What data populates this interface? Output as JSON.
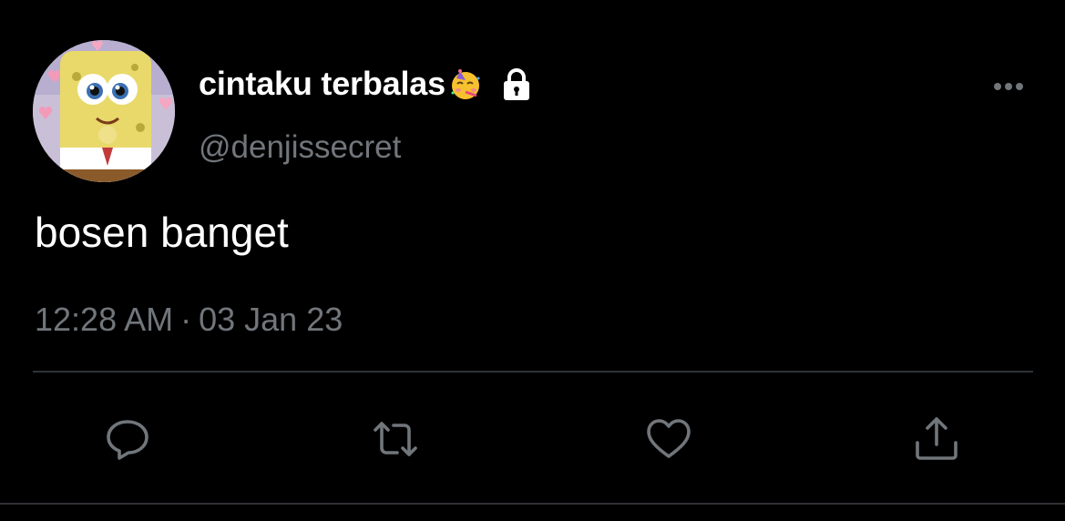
{
  "author": {
    "display_name": "cintaku terbalas",
    "name_emoji": "partying-face-emoji",
    "protected_icon": "lock-icon",
    "handle": "@denjissecret"
  },
  "tweet": {
    "text": "bosen banget",
    "time": "12:28 AM",
    "separator": "·",
    "date": "03 Jan 23"
  },
  "actions": [
    {
      "name": "reply",
      "icon": "reply-icon"
    },
    {
      "name": "retweet",
      "icon": "retweet-icon"
    },
    {
      "name": "like",
      "icon": "heart-icon"
    },
    {
      "name": "share",
      "icon": "share-icon"
    }
  ],
  "colors": {
    "background": "#000000",
    "primary_text": "#ffffff",
    "secondary_text": "#71767b",
    "icon": "#71767b",
    "divider": "#2f3336"
  }
}
